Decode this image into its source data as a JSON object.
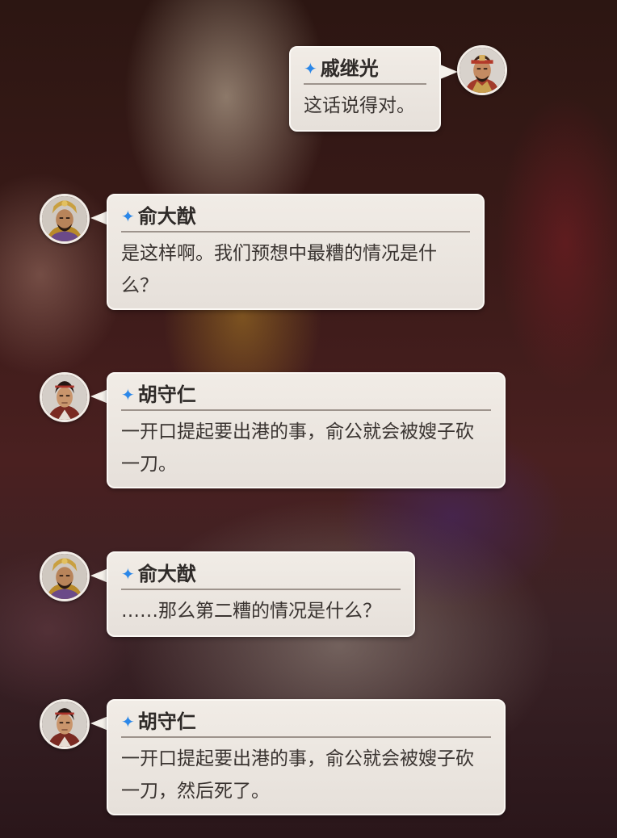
{
  "dialogue": [
    {
      "speaker": "戚继光",
      "text": "这话说得对。",
      "avatar": "qi-jiguang-portrait-icon"
    },
    {
      "speaker": "俞大猷",
      "text": "是这样啊。我们预想中最糟的情况是什么？",
      "avatar": "yu-dayou-portrait-icon"
    },
    {
      "speaker": "胡守仁",
      "text": "一开口提起要出港的事，俞公就会被嫂子砍一刀。",
      "avatar": "hu-shouren-portrait-icon"
    },
    {
      "speaker": "俞大猷",
      "text": "……那么第二糟的情况是什么？",
      "avatar": "yu-dayou-portrait-icon"
    },
    {
      "speaker": "胡守仁",
      "text": "一开口提起要出港的事，俞公就会被嫂子砍一刀，然后死了。",
      "avatar": "hu-shouren-portrait-icon"
    }
  ],
  "colors": {
    "star": "#2b87e8",
    "bubble": "#ede8e2",
    "speaker_text": "#2e2a28",
    "body_text": "#3a3431"
  }
}
